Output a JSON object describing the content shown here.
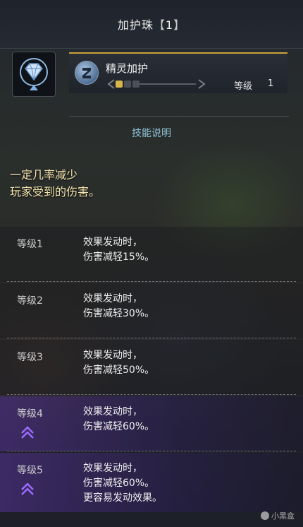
{
  "header": {
    "title": "加护珠",
    "bracket_open": "【",
    "bracket_value": "1",
    "bracket_close": "】"
  },
  "decoration": {
    "icon": "diamond-gem-icon"
  },
  "skill": {
    "icon": "shield-skill-icon",
    "name": "精灵加护",
    "level_label": "等级",
    "level_value": "1",
    "level_progress": 0.33
  },
  "description_header": "技能说明",
  "description": {
    "line1": "一定几率减少",
    "line2": "玩家受到的伤害。"
  },
  "levels": [
    {
      "label": "等级1",
      "effect_line1": "效果发动时，",
      "effect_line2": "伤害减轻15%。",
      "effect_line3": "",
      "upgrade": false
    },
    {
      "label": "等级2",
      "effect_line1": "效果发动时，",
      "effect_line2": "伤害减轻30%。",
      "effect_line3": "",
      "upgrade": false
    },
    {
      "label": "等级3",
      "effect_line1": "效果发动时，",
      "effect_line2": "伤害减轻50%。",
      "effect_line3": "",
      "upgrade": false
    },
    {
      "label": "等级4",
      "effect_line1": "效果发动时，",
      "effect_line2": "伤害减轻60%。",
      "effect_line3": "",
      "upgrade": true,
      "upgrade_icon": "double-chevron-up-icon"
    },
    {
      "label": "等级5",
      "effect_line1": "效果发动时，",
      "effect_line2": "伤害减轻60%。",
      "effect_line3": "更容易发动效果。",
      "upgrade": true,
      "upgrade_icon": "double-chevron-up-icon"
    }
  ],
  "watermark": "小黑盒",
  "colors": {
    "accent_gold": "#c9a23a",
    "desc_text": "#f6e7b0",
    "header_blue": "#8fc2d6",
    "upgrade_purple": "#7a4fd6"
  }
}
